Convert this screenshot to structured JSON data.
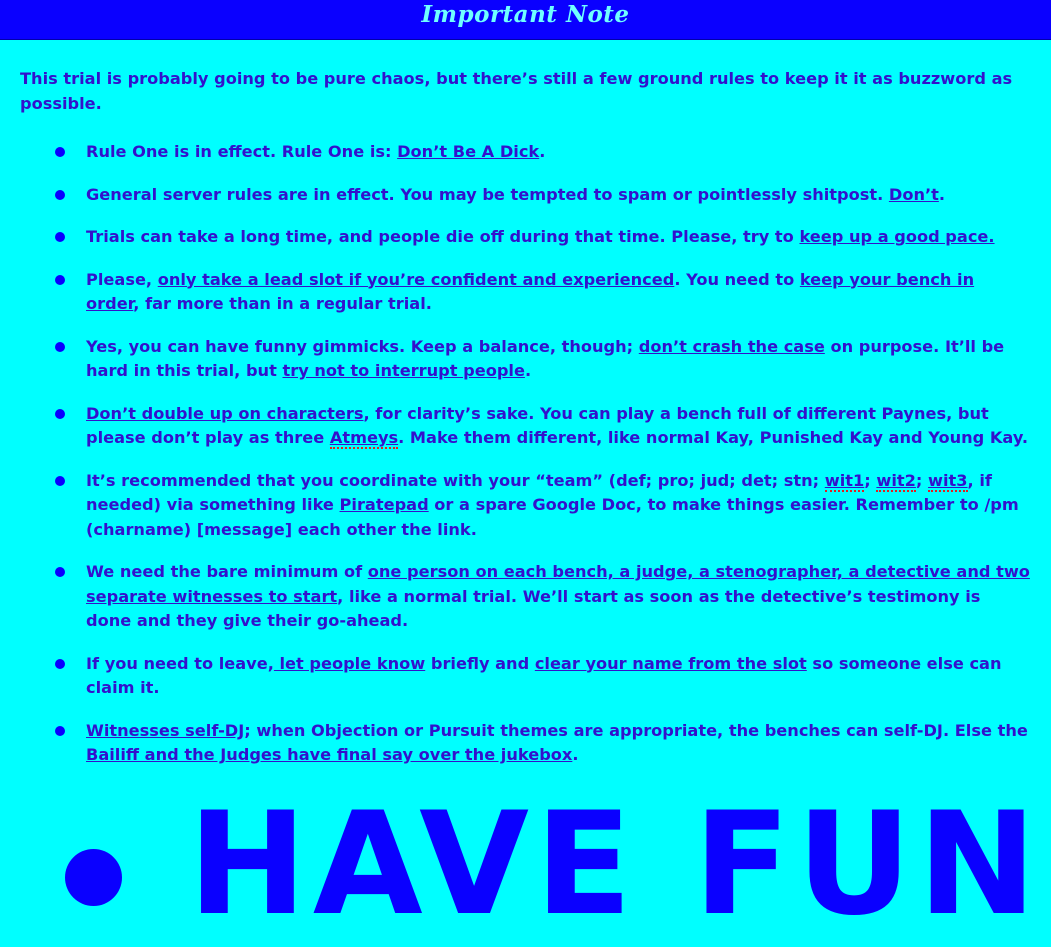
{
  "header": {
    "title": "Important Note"
  },
  "intro": "This trial is probably going to be pure chaos, but there’s still a few ground rules to keep it it as buzzword as possible.",
  "rules": [
    {
      "t1": "Rule One is in effect. Rule One is: ",
      "u1": "Don’t Be A Dick",
      "t2": "."
    },
    {
      "t1": "General server rules are in effect. You may be tempted to spam or pointlessly shitpost. ",
      "u1": "Don’t",
      "t2": "."
    },
    {
      "t1": "Trials can take a long time, and people die off during that time. Please, try to ",
      "u1": "keep up a good pace."
    },
    {
      "t1": "Please, ",
      "u1": "only take a lead slot if you’re confident and experienced",
      "t2": ". You need to ",
      "u2": "keep your bench in order",
      "t3": ", far more than in a regular trial."
    },
    {
      "t1": "Yes, you can have funny gimmicks. Keep a balance, though; ",
      "u1": "don’t crash the case",
      "t2": " on purpose. It’ll be hard in this trial, but ",
      "u2": "try not to interrupt people",
      "t3": "."
    },
    {
      "u1": "Don’t double up on characters",
      "t1": ", for clarity’s sake. You can play a bench full of different Paynes, but please don’t play as three ",
      "s1": "Atmeys",
      "t2": ". Make them different, like normal Kay, Punished Kay and Young Kay."
    },
    {
      "t1": "It’s recommended that you coordinate with your “team” (def; pro; jud; det; stn; ",
      "s1": "wit1",
      "t2": "; ",
      "s2": "wit2",
      "t3": "; ",
      "s3": "wit3",
      "t4": ", if needed) via something like ",
      "u1": "Piratepad",
      "t5": " or a spare Google Doc, to make things easier. Remember to /pm (charname) [message] each other the link."
    },
    {
      "t1": "We need the bare minimum of ",
      "u1": "one person on each bench, a judge, a stenographer, a detective and two separate witnesses to start",
      "t2": ", like a normal trial. We’ll start as soon as the detective’s testimony is done and they give their go-ahead."
    },
    {
      "t1": "If you need to leave,",
      "u1": " let people know",
      "t2": " briefly and ",
      "u2": "clear your name from the slot",
      "t3": " so someone else can claim it."
    },
    {
      "u1": "Witnesses self-DJ",
      "t1": "; when Objection or Pursuit themes are appropriate, the benches can self-DJ. Else the ",
      "u2": "Bailiff and the Judges have final say over the jukebox",
      "t2": "."
    }
  ],
  "big_note": "HAVE FUN"
}
